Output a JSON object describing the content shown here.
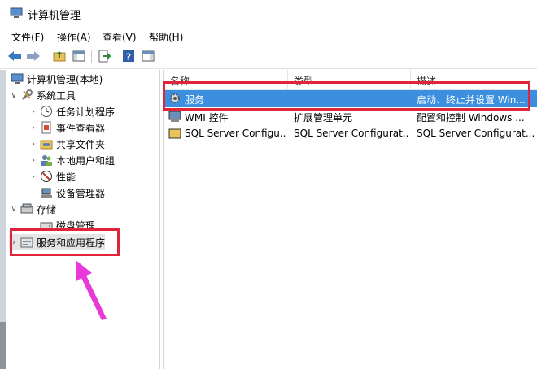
{
  "window": {
    "title": "计算机管理"
  },
  "menu": [
    "文件(F)",
    "操作(A)",
    "查看(V)",
    "帮助(H)"
  ],
  "toolbar": {
    "buttons": [
      "back-icon",
      "forward-icon",
      "up-folder-icon",
      "show-hide-tree-icon",
      "export-list-icon",
      "help-icon",
      "properties-pane-icon"
    ]
  },
  "tree": {
    "root": "计算机管理(本地)",
    "system_tools": "系统工具",
    "task_scheduler": "任务计划程序",
    "event_viewer": "事件查看器",
    "shared_folders": "共享文件夹",
    "local_users": "本地用户和组",
    "performance": "性能",
    "device_manager": "设备管理器",
    "storage": "存储",
    "disk_management": "磁盘管理",
    "services_apps": "服务和应用程序"
  },
  "list": {
    "columns": [
      "名称",
      "类型",
      "描述"
    ],
    "rows": [
      {
        "name": "服务",
        "type": "",
        "desc": "启动、终止并设置 Win..."
      },
      {
        "name": "WMI 控件",
        "type": "扩展管理单元",
        "desc": "配置和控制 Windows ..."
      },
      {
        "name": "SQL Server Configu...",
        "type": "SQL Server Configurat...",
        "desc": "SQL Server Configurat..."
      }
    ]
  },
  "annotation": {
    "highlight_color": "#e0243a",
    "arrow_color": "#e83ad8"
  }
}
